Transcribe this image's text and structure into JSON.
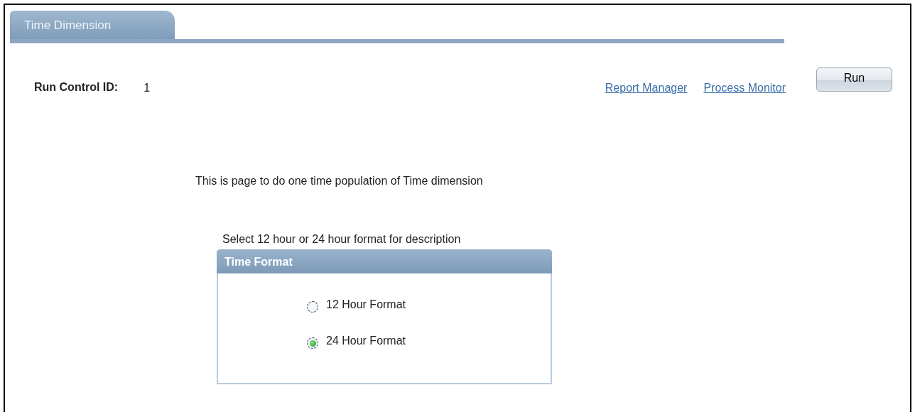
{
  "tabs": [
    {
      "label": "Time Dimension",
      "selected": true
    }
  ],
  "run_control": {
    "label": "Run Control ID:",
    "value": "1"
  },
  "links": [
    "Report Manager",
    "Process Monitor"
  ],
  "run_button": "Run",
  "intro_text": "This is page to do one time population of Time dimension",
  "format_prompt": "Select 12 hour or 24 hour format for description",
  "time_format": {
    "title": "Time Format",
    "options": [
      {
        "label": "12 Hour Format",
        "selected": false
      },
      {
        "label": "24 Hour Format",
        "selected": true
      }
    ]
  }
}
